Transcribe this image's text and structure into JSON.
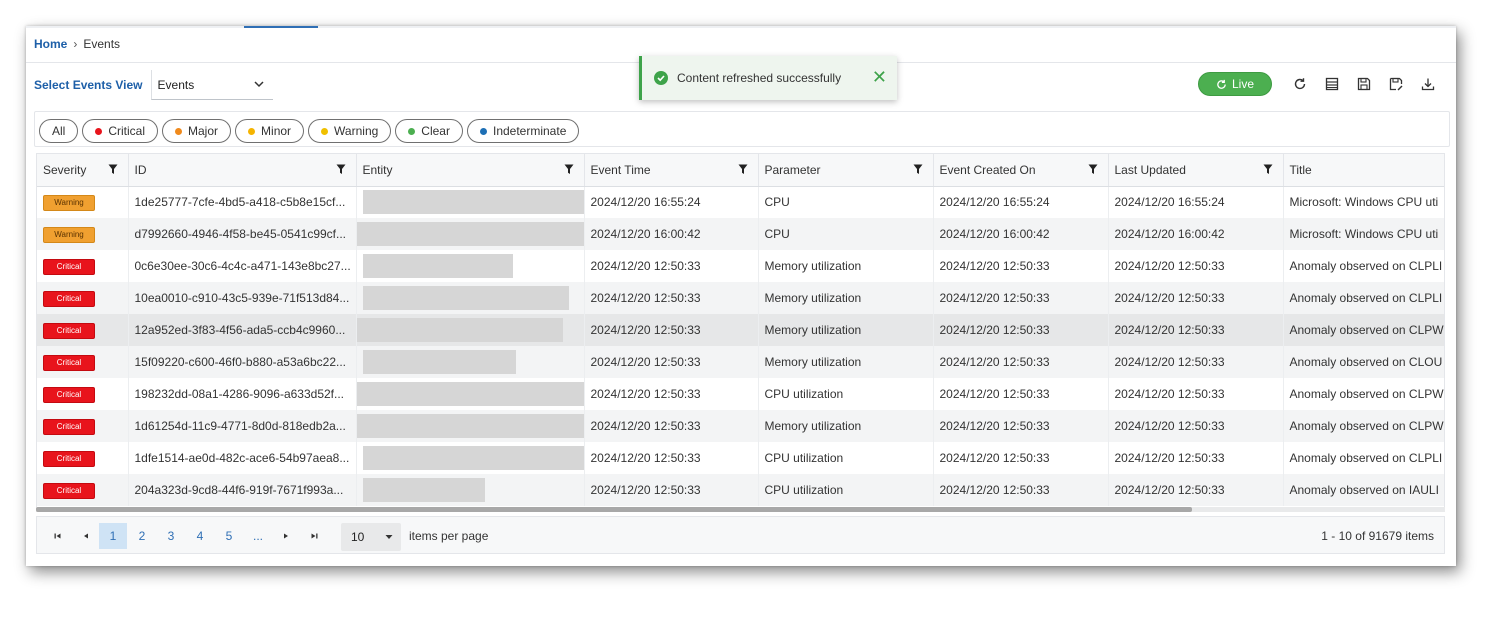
{
  "breadcrumb": {
    "home": "Home",
    "current": "Events"
  },
  "view_selector": {
    "label": "Select Events View",
    "value": "Events"
  },
  "toast": {
    "message": "Content refreshed successfully"
  },
  "toolbar": {
    "live_label": "Live",
    "icons": [
      "refresh-icon",
      "columns-icon",
      "save-icon",
      "save-as-icon",
      "download-icon"
    ]
  },
  "filters": [
    {
      "label": "All",
      "color": ""
    },
    {
      "label": "Critical",
      "color": "#e8141c"
    },
    {
      "label": "Major",
      "color": "#f08a1c"
    },
    {
      "label": "Minor",
      "color": "#f5b400"
    },
    {
      "label": "Warning",
      "color": "#f0c000"
    },
    {
      "label": "Clear",
      "color": "#4caf50"
    },
    {
      "label": "Indeterminate",
      "color": "#1d6fb5"
    }
  ],
  "table": {
    "columns": [
      "Severity",
      "ID",
      "Entity",
      "Event Time",
      "Parameter",
      "Event Created On",
      "Last Updated",
      "Title"
    ],
    "rows": [
      {
        "severity": "Warning",
        "id": "1de25777-7cfe-4bd5-a418-c5b8e15cf...",
        "event_time": "2024/12/20 16:55:24",
        "parameter": "CPU",
        "created": "2024/12/20 16:55:24",
        "updated": "2024/12/20 16:55:24",
        "title": "Microsoft: Windows CPU uti"
      },
      {
        "severity": "Warning",
        "id": "d7992660-4946-4f58-be45-0541c99cf...",
        "event_time": "2024/12/20 16:00:42",
        "parameter": "CPU",
        "created": "2024/12/20 16:00:42",
        "updated": "2024/12/20 16:00:42",
        "title": "Microsoft: Windows CPU uti"
      },
      {
        "severity": "Critical",
        "id": "0c6e30ee-30c6-4c4c-a471-143e8bc27...",
        "event_time": "2024/12/20 12:50:33",
        "parameter": "Memory utilization",
        "created": "2024/12/20 12:50:33",
        "updated": "2024/12/20 12:50:33",
        "title": "Anomaly observed on CLPLI"
      },
      {
        "severity": "Critical",
        "id": "10ea0010-c910-43c5-939e-71f513d84...",
        "event_time": "2024/12/20 12:50:33",
        "parameter": "Memory utilization",
        "created": "2024/12/20 12:50:33",
        "updated": "2024/12/20 12:50:33",
        "title": "Anomaly observed on CLPLI"
      },
      {
        "severity": "Critical",
        "id": "12a952ed-3f83-4f56-ada5-ccb4c9960...",
        "event_time": "2024/12/20 12:50:33",
        "parameter": "Memory utilization",
        "created": "2024/12/20 12:50:33",
        "updated": "2024/12/20 12:50:33",
        "title": "Anomaly observed on CLPW"
      },
      {
        "severity": "Critical",
        "id": "15f09220-c600-46f0-b880-a53a6bc22...",
        "event_time": "2024/12/20 12:50:33",
        "parameter": "Memory utilization",
        "created": "2024/12/20 12:50:33",
        "updated": "2024/12/20 12:50:33",
        "title": "Anomaly observed on CLOU"
      },
      {
        "severity": "Critical",
        "id": "198232dd-08a1-4286-9096-a633d52f...",
        "event_time": "2024/12/20 12:50:33",
        "parameter": "CPU utilization",
        "created": "2024/12/20 12:50:33",
        "updated": "2024/12/20 12:50:33",
        "title": "Anomaly observed on CLPW"
      },
      {
        "severity": "Critical",
        "id": "1d61254d-11c9-4771-8d0d-818edb2a...",
        "event_time": "2024/12/20 12:50:33",
        "parameter": "Memory utilization",
        "created": "2024/12/20 12:50:33",
        "updated": "2024/12/20 12:50:33",
        "title": "Anomaly observed on CLPW"
      },
      {
        "severity": "Critical",
        "id": "1dfe1514-ae0d-482c-ace6-54b97aea8...",
        "event_time": "2024/12/20 12:50:33",
        "parameter": "CPU utilization",
        "created": "2024/12/20 12:50:33",
        "updated": "2024/12/20 12:50:33",
        "title": "Anomaly observed on CLPLI"
      },
      {
        "severity": "Critical",
        "id": "204a323d-9cd8-44f6-919f-7671f993a...",
        "event_time": "2024/12/20 12:50:33",
        "parameter": "CPU utilization",
        "created": "2024/12/20 12:50:33",
        "updated": "2024/12/20 12:50:33",
        "title": "Anomaly observed on IAULI"
      }
    ]
  },
  "pager": {
    "pages": [
      "1",
      "2",
      "3",
      "4",
      "5",
      "..."
    ],
    "active_page": "1",
    "page_size": "10",
    "items_per_page_label": "items per page",
    "info": "1 - 10 of 91679 items"
  },
  "colors": {
    "accent": "#1d5fa8",
    "live": "#4caf50",
    "critical": "#e8141c",
    "warning": "#f0a030"
  }
}
